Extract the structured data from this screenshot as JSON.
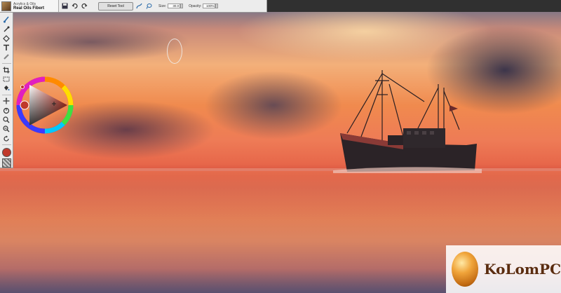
{
  "brush": {
    "category": "Acrylics & Oils",
    "name": "Real Oils Fibert"
  },
  "toolbar": {
    "reset_label": "Reset Tool",
    "size_label": "Size:",
    "size_value": "30.0",
    "opacity_label": "Opacity:",
    "opacity_value": "100%"
  },
  "watermark": {
    "text": "KoLomPC"
  },
  "colors": {
    "current_color": "#c0392b",
    "toolbar_bg": "#ececec",
    "dark_bar": "#303030"
  },
  "icons": {
    "toolbar": [
      "save-icon",
      "undo-icon",
      "redo-icon",
      "transform-icon",
      "lasso-icon"
    ],
    "toolbox": [
      "brush-icon",
      "dropper-icon",
      "fill-icon",
      "text-icon",
      "eraser-icon",
      "crop-icon",
      "select-rect-icon",
      "paint-bucket-icon",
      "move-icon",
      "hand-icon",
      "zoom-in-icon",
      "zoom-out-icon",
      "rotate-icon"
    ]
  }
}
